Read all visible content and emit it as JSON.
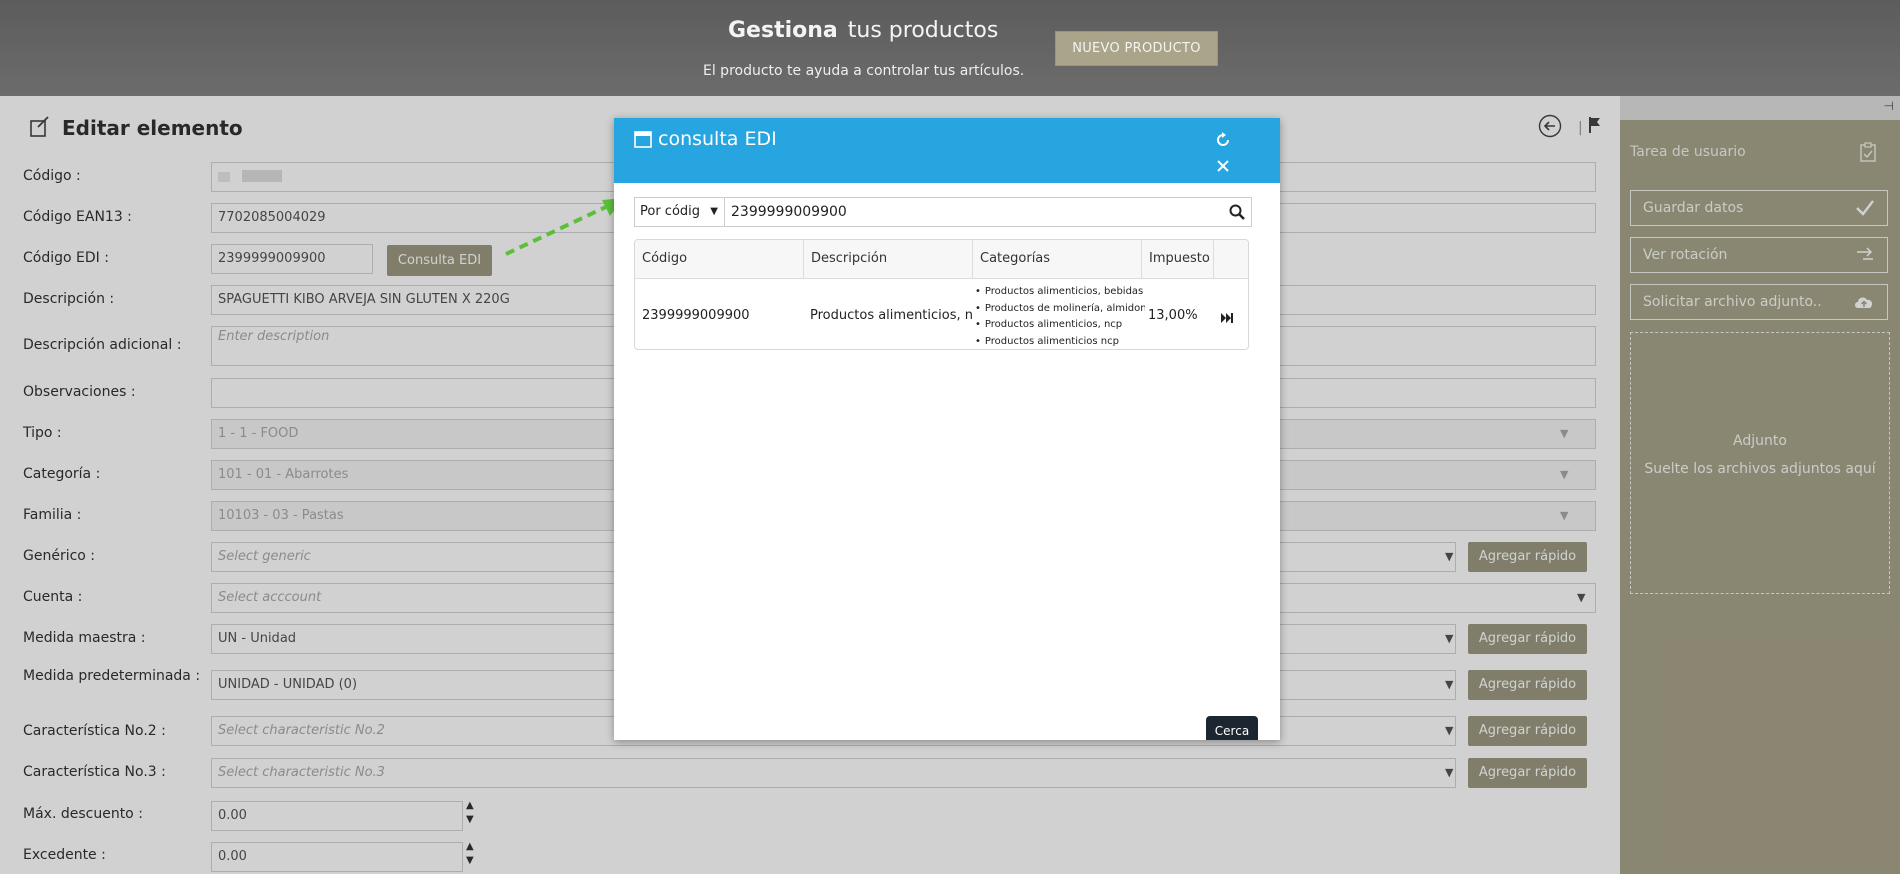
{
  "banner": {
    "title_bold": "Gestiona",
    "title_rest": "tus productos",
    "subtitle": "El producto te ayuda a controlar tus artículos.",
    "new_button": "NUEVO PRODUCTO"
  },
  "form": {
    "title": "Editar elemento",
    "consulta_button": "Consulta EDI",
    "quick_add": "Agregar rápido",
    "rows": {
      "codigo": {
        "label": "Código :",
        "value": ""
      },
      "ean13": {
        "label": "Código EAN13 :",
        "value": "7702085004029"
      },
      "edi": {
        "label": "Código EDI :",
        "value": "2399999009900"
      },
      "descripcion": {
        "label": "Descripción :",
        "value": "SPAGUETTI KIBO ARVEJA SIN GLUTEN  X 220G"
      },
      "desc_adicional": {
        "label": "Descripción adicional :",
        "placeholder": "Enter description"
      },
      "observaciones": {
        "label": "Observaciones :",
        "value": ""
      },
      "tipo": {
        "label": "Tipo :",
        "value": "1 - 1 - FOOD"
      },
      "categoria": {
        "label": "Categoría :",
        "value": "101 - 01 - Abarrotes"
      },
      "familia": {
        "label": "Familia :",
        "value": "10103 - 03 - Pastas"
      },
      "generico": {
        "label": "Genérico :",
        "placeholder": "Select generic"
      },
      "cuenta": {
        "label": "Cuenta :",
        "placeholder": "Select acccount"
      },
      "medida_maestra": {
        "label": "Medida maestra :",
        "value": "UN - Unidad"
      },
      "medida_pred": {
        "label": "Medida predeterminada :",
        "value": "UNIDAD - UNIDAD (0)"
      },
      "caract2": {
        "label": "Característica No.2 :",
        "placeholder": "Select characteristic No.2"
      },
      "caract3": {
        "label": "Característica No.3 :",
        "placeholder": "Select characteristic No.3"
      },
      "max_descuento": {
        "label": "Máx. descuento :",
        "value": "0.00"
      },
      "excedente": {
        "label": "Excedente :",
        "value": "0.00"
      }
    }
  },
  "right_panel": {
    "task_label": "Tarea de usuario",
    "save": "Guardar datos",
    "rotation": "Ver rotación",
    "request_attachment": "Solicitar archivo adjunto..",
    "dropzone_title": "Adjunto",
    "dropzone_sub": "Suelte los archivos adjuntos aquí"
  },
  "modal": {
    "title": "consulta EDI",
    "search_mode": "Por códig",
    "search_value": "2399999009900",
    "columns": [
      "Código",
      "Descripción",
      "Categorías",
      "Impuesto"
    ],
    "row": {
      "codigo": "2399999009900",
      "descripcion": "Productos alimenticios, ncp",
      "categorias": [
        "Productos alimenticios, bebidas y t",
        "Productos de molinería, almidone",
        "Productos alimenticios, ncp",
        "Productos alimenticios ncp"
      ],
      "impuesto": "13,00%"
    },
    "close_button": "Cerca"
  },
  "colors": {
    "modal_header": "#27a5e0",
    "accent_button": "#9d9a83",
    "panel": "#a8a48a",
    "arrow": "#5cbf3a"
  }
}
